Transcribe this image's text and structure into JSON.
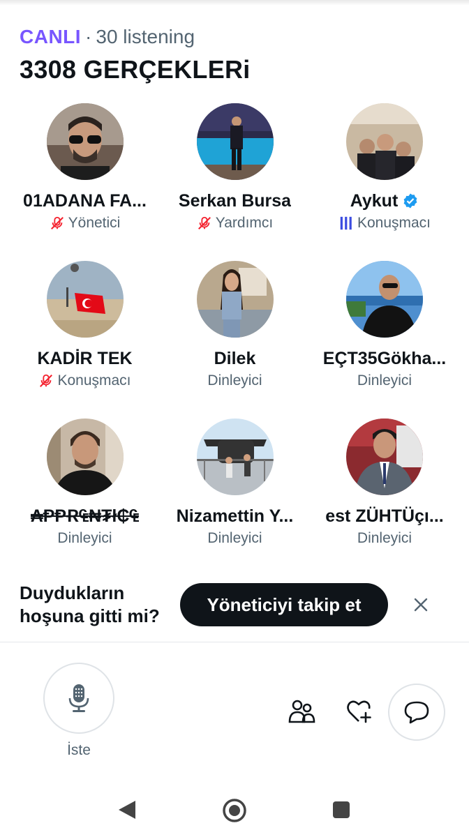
{
  "header": {
    "live_label": "CANLI",
    "separator": "·",
    "listening": "30 listening",
    "title": "3308 GERÇEKLERi"
  },
  "participants": [
    {
      "name": "01ADANA FA...",
      "role": "Yönetici",
      "role_icon": "muted-mic-icon",
      "verified": false
    },
    {
      "name": "Serkan Bursa",
      "role": "Yardımcı",
      "role_icon": "muted-mic-icon",
      "verified": false
    },
    {
      "name": "Aykut",
      "role": "Konuşmacı",
      "role_icon": "speaking-bars-icon",
      "verified": true
    },
    {
      "name": "KADİR TEK",
      "role": "Konuşmacı",
      "role_icon": "muted-mic-icon",
      "verified": false
    },
    {
      "name": "Dilek",
      "role": "Dinleyici",
      "role_icon": "none",
      "verified": false
    },
    {
      "name": "EÇT35Gökha...",
      "role": "Dinleyici",
      "role_icon": "none",
      "verified": false
    },
    {
      "name": "₳ⱣⱣɌ₠₦₮ł₵₠",
      "role": "Dinleyici",
      "role_icon": "none",
      "verified": false
    },
    {
      "name": "Nizamettin Y...",
      "role": "Dinleyici",
      "role_icon": "none",
      "verified": false
    },
    {
      "name": "est ZÜHTÜçı...",
      "role": "Dinleyici",
      "role_icon": "none",
      "verified": false
    }
  ],
  "prompt": {
    "text": "Duydukların hoşuna gitti mi?",
    "follow_label": "Yöneticiyi takip et"
  },
  "controls": {
    "mic_label": "İste"
  },
  "colors": {
    "live": "#7856ff",
    "muted": "#f4212e",
    "speaking": "#3b4ce0",
    "verified": "#1d9bf0",
    "text_secondary": "#536471"
  }
}
